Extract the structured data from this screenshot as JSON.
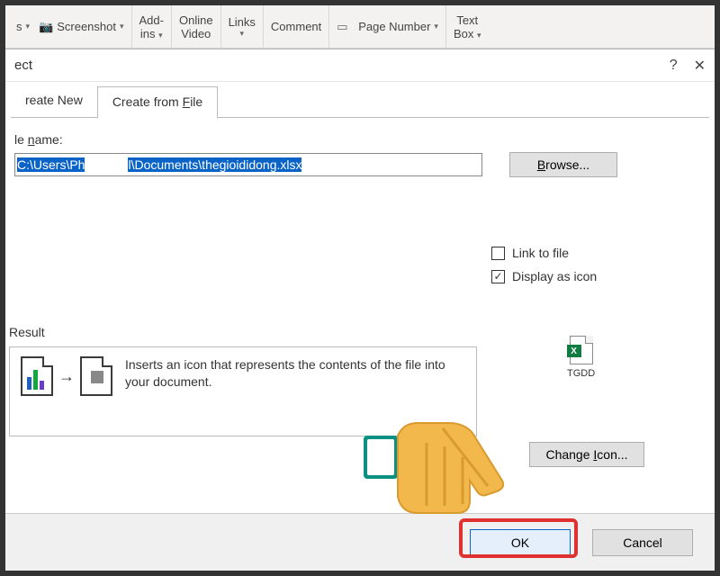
{
  "ribbon": {
    "s": "s",
    "screenshot": "Screenshot",
    "addins1": "Add-",
    "addins2": "ins",
    "video1": "Online",
    "video2": "Video",
    "links": "Links",
    "comment": "Comment",
    "pagenum": "Page Number",
    "textbox1": "Text",
    "textbox2": "Box"
  },
  "dialog": {
    "title": "ect",
    "help": "?",
    "close": "✕"
  },
  "tabs": {
    "createnew": "reate New",
    "fromfile": "Create from File"
  },
  "filelabel": "le name:",
  "path": {
    "p1": "C:\\Users\\Ph",
    "p2": "l",
    "p3": "\\Documents\\thegioididong.xlsx"
  },
  "browse": "Browse...",
  "checks": {
    "link": "Link to file",
    "display": "Display as icon",
    "link_checked": false,
    "display_checked": true
  },
  "result": {
    "title": "Result",
    "text": "Inserts an icon that represents the contents of the file into your document."
  },
  "iconlabel": "TGDD",
  "changeicon": "Change Icon...",
  "buttons": {
    "ok": "OK",
    "cancel": "Cancel"
  }
}
